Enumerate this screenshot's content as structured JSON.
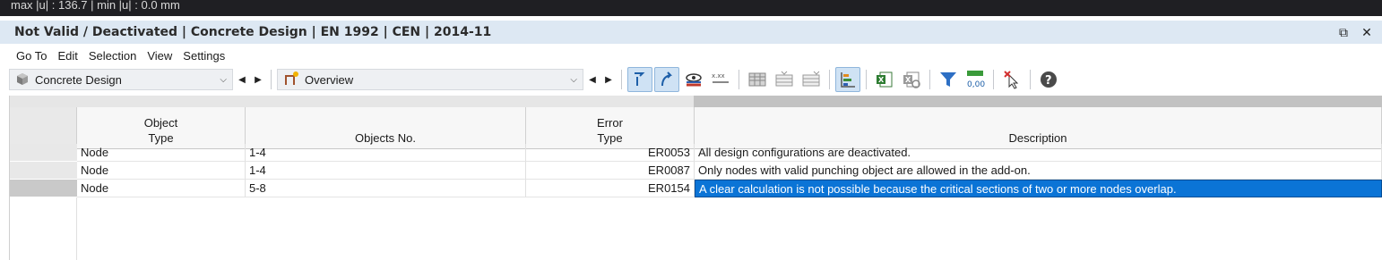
{
  "top_strip": {
    "text": "max |u| : 136.7 | min |u| : 0.0 mm"
  },
  "window": {
    "title": "Not Valid / Deactivated | Concrete Design | EN 1992 | CEN | 2014-11",
    "restore_glyph": "⧉",
    "close_glyph": "✕"
  },
  "menu": [
    "Go To",
    "Edit",
    "Selection",
    "View",
    "Settings"
  ],
  "toolbar": {
    "module_combo": {
      "label": "Concrete Design",
      "icon": "concrete-design-icon"
    },
    "view_combo": {
      "label": "Overview",
      "icon": "overview-icon"
    },
    "chevron": "⌵",
    "prev": "◀",
    "next": "▶",
    "decimals_label": "0,00",
    "xxx_label": "x.xx"
  },
  "table": {
    "columns": [
      {
        "key": "object_type",
        "header_line1": "Object",
        "header_line2": "Type"
      },
      {
        "key": "objects_no",
        "header_line1": "",
        "header_line2": "Objects No."
      },
      {
        "key": "error_type",
        "header_line1": "Error",
        "header_line2": "Type"
      },
      {
        "key": "description",
        "header_line1": "",
        "header_line2": "Description"
      }
    ],
    "rows": [
      {
        "object_type": "Node",
        "objects_no": "1-4",
        "error_type": "ER0053",
        "description": "All design configurations are deactivated."
      },
      {
        "object_type": "Node",
        "objects_no": "1-4",
        "error_type": "ER0087",
        "description": "Only nodes with valid punching object are allowed in the add-on."
      },
      {
        "object_type": "Node",
        "objects_no": "5-8",
        "error_type": "ER0154",
        "description": "A clear calculation is not possible because the critical sections of two or more nodes overlap."
      }
    ]
  },
  "colors": {
    "title_bar": "#dde8f3",
    "selection": "#0b74d6",
    "active_button": "#cfe2f4"
  }
}
